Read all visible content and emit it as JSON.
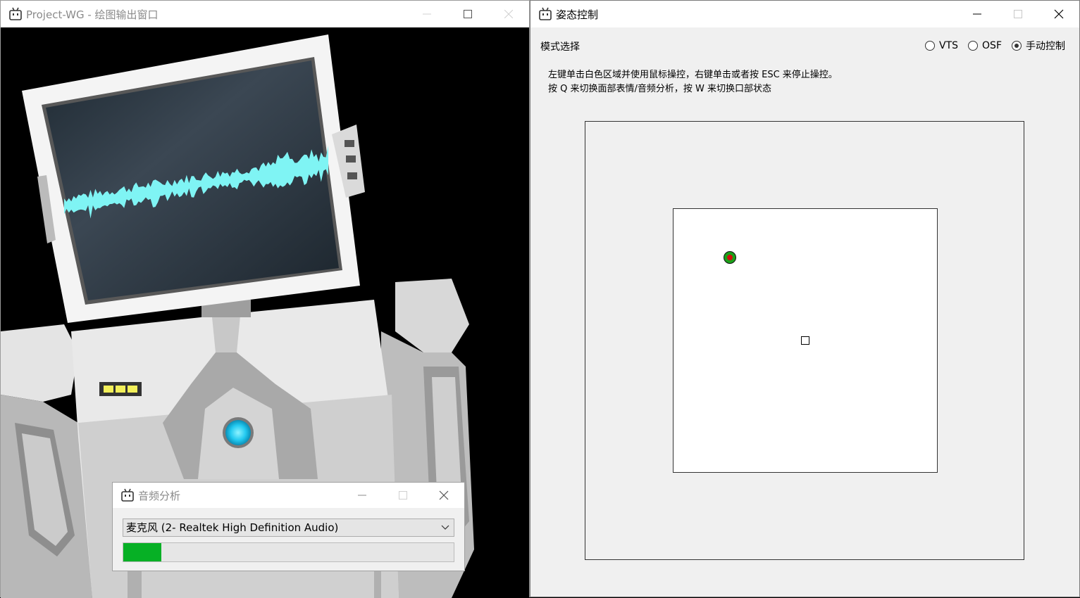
{
  "render_window": {
    "title": "Project-WG - 绘图输出窗口",
    "icons": {
      "app": "robot-icon",
      "minimize": "minimize-icon",
      "maximize": "maximize-icon",
      "close": "close-icon"
    }
  },
  "pose_window": {
    "title": "姿态控制",
    "mode_label": "模式选择",
    "modes": [
      {
        "label": "VTS",
        "selected": false
      },
      {
        "label": "OSF",
        "selected": false
      },
      {
        "label": "手动控制",
        "selected": true
      }
    ],
    "hint_line1": "左键单击白色区域并使用鼠标操控，右键单击或者按 ESC 来停止操控。",
    "hint_line2": "按 Q 来切换面部表情/音频分析，按 W 来切换口部状态"
  },
  "audio_window": {
    "title": "音频分析",
    "device": "麦克风 (2- Realtek High Definition Audio)",
    "level": 0.115,
    "level_color": "#06b025"
  },
  "colors": {
    "waveform": "#7ff4f4",
    "screen": "#2e3a45",
    "eye_light": "#2fd3f5"
  }
}
